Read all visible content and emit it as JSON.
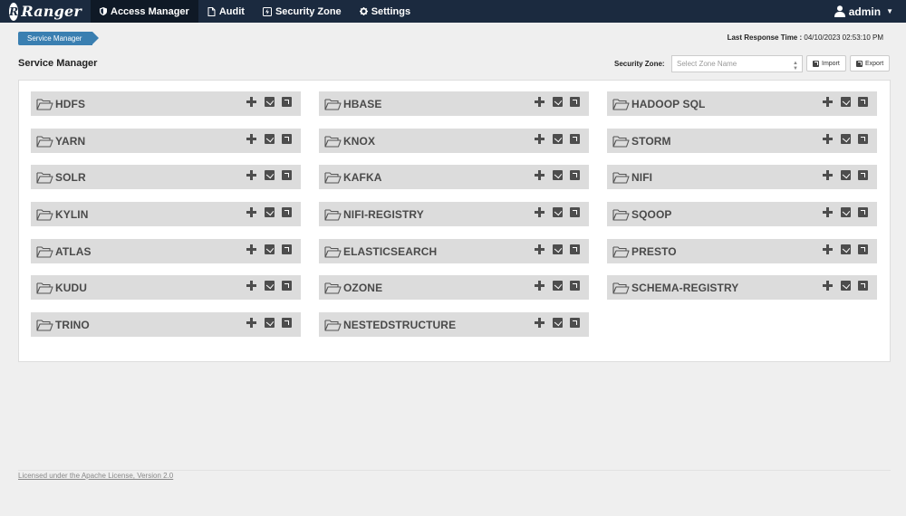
{
  "navbar": {
    "brand": "Ranger",
    "brand_logo_letter": "R",
    "items": [
      {
        "label": "Access Manager",
        "icon": "shield-icon",
        "active": true
      },
      {
        "label": "Audit",
        "icon": "file-icon",
        "active": false
      },
      {
        "label": "Security Zone",
        "icon": "zone-icon",
        "active": false
      },
      {
        "label": "Settings",
        "icon": "gear-icon",
        "active": false
      }
    ],
    "user": "admin"
  },
  "breadcrumb": "Service Manager",
  "last_response": {
    "label": "Last Response Time :",
    "value": "04/10/2023 02:53:10 PM"
  },
  "page_title": "Service Manager",
  "zone": {
    "label": "Security Zone:",
    "placeholder": "Select Zone Name"
  },
  "buttons": {
    "import": "Import",
    "export": "Export"
  },
  "services": {
    "col1": [
      "HDFS",
      "YARN",
      "SOLR",
      "KYLIN",
      "ATLAS",
      "KUDU",
      "TRINO"
    ],
    "col2": [
      "HBASE",
      "KNOX",
      "KAFKA",
      "NIFI-REGISTRY",
      "ELASTICSEARCH",
      "OZONE",
      "NESTEDSTRUCTURE"
    ],
    "col3": [
      "HADOOP SQL",
      "STORM",
      "NIFI",
      "SQOOP",
      "PRESTO",
      "SCHEMA-REGISTRY"
    ]
  },
  "footer": "Licensed under the Apache License, Version 2.0",
  "colors": {
    "navbar": "#1b2a3f",
    "breadcrumb": "#3a7fb1",
    "service_bg": "#dcdcdc"
  }
}
